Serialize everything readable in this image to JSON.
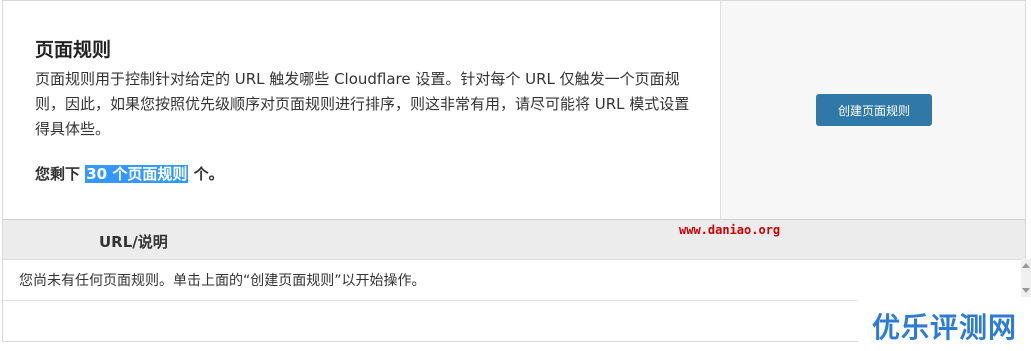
{
  "panel": {
    "title": "页面规则",
    "description": "页面规则用于控制针对给定的 URL 触发哪些 Cloudflare 设置。针对每个 URL 仅触发一个页面规则，因此，如果您按照优先级顺序对页面规则进行排序，则这非常有用，请尽可能将 URL 模式设置得具体些。",
    "remaining_prefix": "您剩下",
    "remaining_highlight": "30 个页面规则",
    "remaining_suffix": "个。",
    "create_button_label": "创建页面规则"
  },
  "table": {
    "columns": [
      "URL/说明"
    ],
    "empty_message": "您尚未有任何页面规则。单击上面的“创建页面规则”以开始操作。"
  },
  "watermark": {
    "url_text": "www.daniao.org",
    "brand_text": "优乐评测网"
  },
  "colors": {
    "button_bg": "#2f78a8",
    "highlight_bg": "#3399ff",
    "header_bg": "#ececec",
    "right_panel_bg": "#f7f7f7",
    "watermark_url": "#cc0000",
    "brand": "#2d7bd2"
  }
}
